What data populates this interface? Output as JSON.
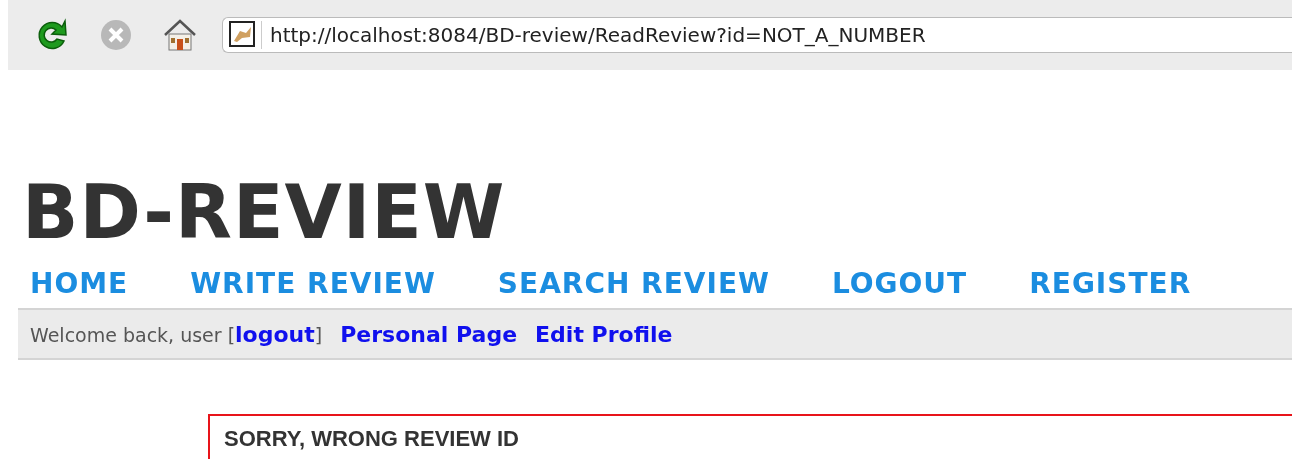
{
  "toolbar": {
    "url": "http://localhost:8084/BD-review/ReadReview?id=NOT_A_NUMBER"
  },
  "site_title": "BD-REVIEW",
  "nav": [
    {
      "label": "HOME"
    },
    {
      "label": "WRITE REVIEW"
    },
    {
      "label": "SEARCH REVIEW"
    },
    {
      "label": "LOGOUT"
    },
    {
      "label": "REGISTER"
    }
  ],
  "user_bar": {
    "welcome_before": "Welcome back, user [",
    "logout_link": "logout",
    "welcome_after": "]",
    "links": [
      "Personal Page",
      "Edit Profile"
    ]
  },
  "error_message": "SORRY, WRONG REVIEW ID"
}
